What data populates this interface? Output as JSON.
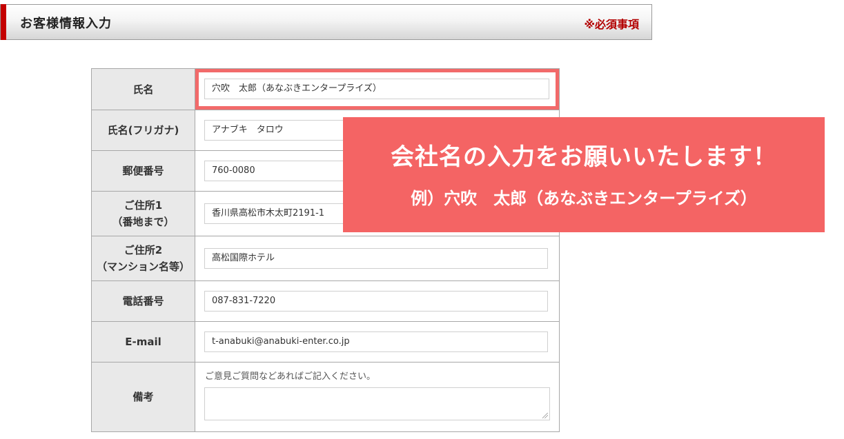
{
  "header": {
    "title": "お客様情報入力",
    "required_note": "※必須事項"
  },
  "form": {
    "rows": [
      {
        "label": "氏名",
        "value": "穴吹　太郎（あなぶきエンタープライズ）"
      },
      {
        "label": "氏名(フリガナ)",
        "value": "アナブキ　タロウ"
      },
      {
        "label": "郵便番号",
        "value": "760-0080"
      },
      {
        "label": [
          "ご住所1",
          "（番地まで）"
        ],
        "value": "香川県高松市木太町2191-1"
      },
      {
        "label": [
          "ご住所2",
          "（マンション名等）"
        ],
        "value": "高松国際ホテル"
      },
      {
        "label": "電話番号",
        "value": "087-831-7220"
      },
      {
        "label": "E-mail",
        "value": "t-anabuki@anabuki-enter.co.jp"
      },
      {
        "label": "備考",
        "placeholder": "ご意見ご質問などあればご記入ください。",
        "value": ""
      }
    ]
  },
  "callout": {
    "line1": "会社名の入力をお願いいたします！",
    "line2": "例）穴吹　太郎（あなぶきエンタープライズ）"
  },
  "colors": {
    "accent": "#c40000",
    "callout_bg": "#f46464",
    "highlight_border": "#f26a6a",
    "required_text": "#b30000"
  }
}
